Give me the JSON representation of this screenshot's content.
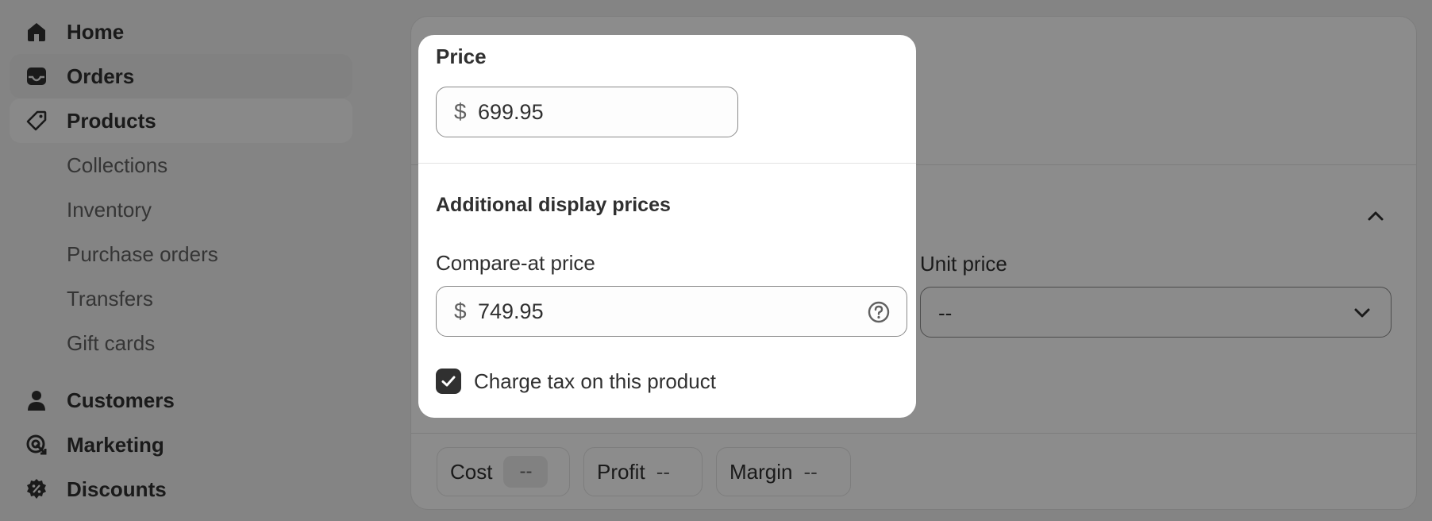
{
  "sidebar": {
    "items": [
      {
        "label": "Home",
        "icon": "home-icon"
      },
      {
        "label": "Orders",
        "icon": "inbox-icon"
      },
      {
        "label": "Products",
        "icon": "tag-icon"
      },
      {
        "label": "Customers",
        "icon": "person-icon"
      },
      {
        "label": "Marketing",
        "icon": "target-icon"
      },
      {
        "label": "Discounts",
        "icon": "discount-icon"
      }
    ],
    "subitems": [
      "Collections",
      "Inventory",
      "Purchase orders",
      "Transfers",
      "Gift cards"
    ]
  },
  "pricing_card": {
    "unit_price_label": "Unit price",
    "unit_price_value": "--",
    "cost_label": "Cost",
    "cost_value": "--",
    "profit_label": "Profit",
    "profit_value": "--",
    "margin_label": "Margin",
    "margin_value": "--"
  },
  "popover": {
    "title": "Price",
    "currency_symbol": "$",
    "price_value": "699.95",
    "section_heading": "Additional display prices",
    "compare_label": "Compare-at price",
    "compare_value": "749.95",
    "charge_tax_label": "Charge tax on this product",
    "charge_tax_checked": true
  },
  "colors": {
    "text": "#303030",
    "muted": "#616161",
    "overlay": "rgba(0,0,0,0.45)",
    "checkbox": "#303030"
  }
}
